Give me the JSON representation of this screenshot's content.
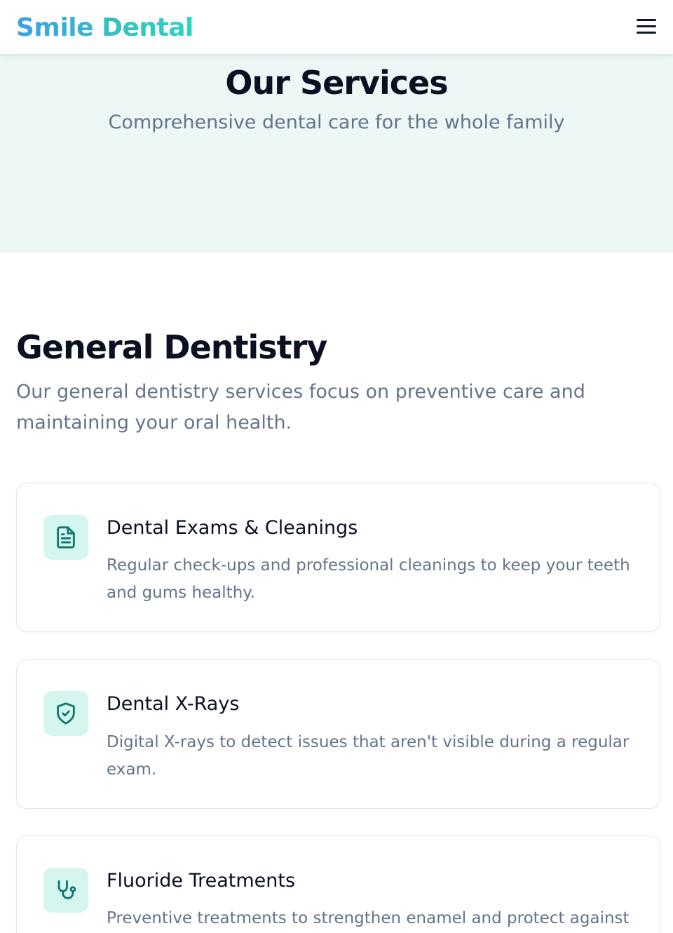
{
  "header": {
    "logo": "Smile Dental",
    "menu_icon": "hamburger-menu-icon"
  },
  "hero": {
    "title": "Our Services",
    "subtitle": "Comprehensive dental care for the whole family"
  },
  "section": {
    "title": "General Dentistry",
    "description": "Our general dentistry services focus on preventive care and maintaining your oral health."
  },
  "services": [
    {
      "icon": "document-icon",
      "title": "Dental Exams & Cleanings",
      "description": "Regular check-ups and professional cleanings to keep your teeth and gums healthy."
    },
    {
      "icon": "shield-check-icon",
      "title": "Dental X-Rays",
      "description": "Digital X-rays to detect issues that aren't visible during a regular exam."
    },
    {
      "icon": "stethoscope-icon",
      "title": "Fluoride Treatments",
      "description": "Preventive treatments to strengthen enamel and protect against"
    }
  ],
  "colors": {
    "accent": "#0f766e",
    "icon_bg": "#d5f5ef",
    "hero_bg": "#edf7f6",
    "logo_gradient_start": "#3b9fe6",
    "logo_gradient_end": "#2dd4bf"
  }
}
